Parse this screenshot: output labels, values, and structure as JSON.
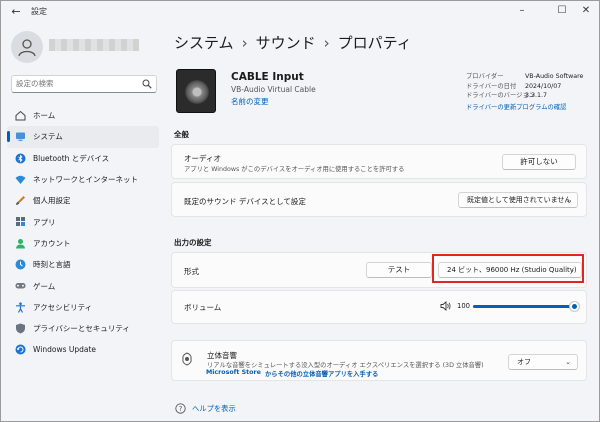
{
  "app": {
    "title": "設定"
  },
  "window_controls": {
    "minimize": "–",
    "maximize": "☐",
    "close": "✕"
  },
  "search": {
    "placeholder": "設定の検索"
  },
  "sidebar": {
    "items": [
      {
        "label": "ホーム",
        "icon": "home-icon"
      },
      {
        "label": "システム",
        "icon": "system-icon",
        "active": true
      },
      {
        "label": "Bluetooth とデバイス",
        "icon": "bluetooth-icon"
      },
      {
        "label": "ネットワークとインターネット",
        "icon": "network-icon"
      },
      {
        "label": "個人用設定",
        "icon": "personalization-icon"
      },
      {
        "label": "アプリ",
        "icon": "apps-icon"
      },
      {
        "label": "アカウント",
        "icon": "account-icon"
      },
      {
        "label": "時刻と言語",
        "icon": "time-language-icon"
      },
      {
        "label": "ゲーム",
        "icon": "gaming-icon"
      },
      {
        "label": "アクセシビリティ",
        "icon": "accessibility-icon"
      },
      {
        "label": "プライバシーとセキュリティ",
        "icon": "privacy-icon"
      },
      {
        "label": "Windows Update",
        "icon": "windows-update-icon"
      }
    ]
  },
  "breadcrumb": {
    "part1": "システム",
    "part2": "サウンド",
    "part3": "プロパティ",
    "sep": "›"
  },
  "device": {
    "name": "CABLE Input",
    "subtitle": "VB-Audio Virtual Cable",
    "rename": "名前の変更"
  },
  "driver_info": {
    "provider_label": "プロバイダー",
    "provider_value": "VB-Audio Software",
    "date_label": "ドライバーの日付",
    "date_value": "2024/10/07",
    "version_label": "ドライバーのバージョン",
    "version_value": "3.3.1.7",
    "update_link": "ドライバーの更新プログラムの確認"
  },
  "general": {
    "section_title": "全般",
    "audio_title": "オーディオ",
    "audio_desc": "アプリと Windows がこのデバイスをオーディオ用に使用することを許可する",
    "audio_button": "許可しない",
    "default_title": "既定のサウンド デバイスとして設定",
    "default_dropdown": "既定値として使用されていません"
  },
  "output": {
    "section_title": "出力の設定",
    "format_title": "形式",
    "test_button": "テスト",
    "format_dropdown": "24 ビット、96000 Hz (Studio Quality)",
    "volume_title": "ボリューム",
    "volume_value": "100",
    "volume_level": 1.0
  },
  "spatial": {
    "title": "立体音響",
    "desc": "リアルな音響をシミュレートする没入型のオーディオ エクスペリエンスを選択する (3D 立体音響)",
    "store_link_bold": "Microsoft Store",
    "store_link_rest": "からその他の立体音響アプリを入手する",
    "dropdown": "オフ"
  },
  "help": {
    "link": "ヘルプを表示"
  },
  "colors": {
    "accent": "#005fb8",
    "highlight": "#e0261e"
  }
}
